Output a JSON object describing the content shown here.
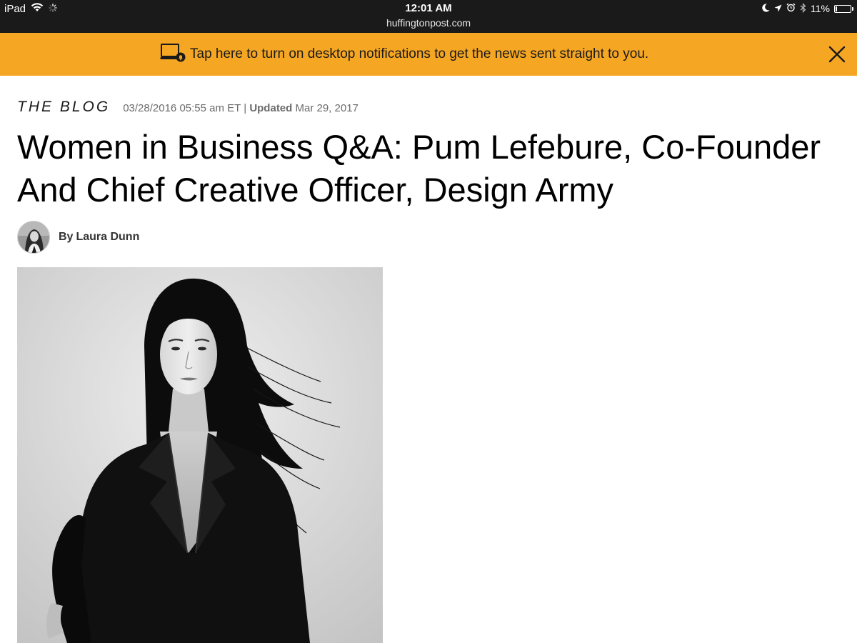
{
  "status_bar": {
    "device": "iPad",
    "time": "12:01 AM",
    "url": "huffingtonpost.com",
    "battery_percent": "11%",
    "battery_level": 0.11,
    "icons": [
      "wifi-icon",
      "loading-spinner-icon",
      "moon-icon",
      "location-arrow-icon",
      "alarm-clock-icon",
      "bluetooth-icon",
      "battery-icon"
    ]
  },
  "banner": {
    "text": "Tap here to turn on desktop notifications to get the news sent straight to you.",
    "icon": "desktop-notification-icon",
    "close_icon": "close-icon",
    "background_color": "#f5a623"
  },
  "article": {
    "section": "THE BLOG",
    "published": "03/28/2016 05:55 am ET",
    "separator": "|",
    "updated_label": "Updated",
    "updated_date": "Mar 29, 2017",
    "title": "Women in Business Q&A: Pum Lefebure, Co-Founder And Chief Creative Officer, Design Army",
    "byline_prefix": "By",
    "author": "Laura Dunn",
    "author_avatar": "author-avatar",
    "hero_image": "black-and-white portrait photo"
  }
}
